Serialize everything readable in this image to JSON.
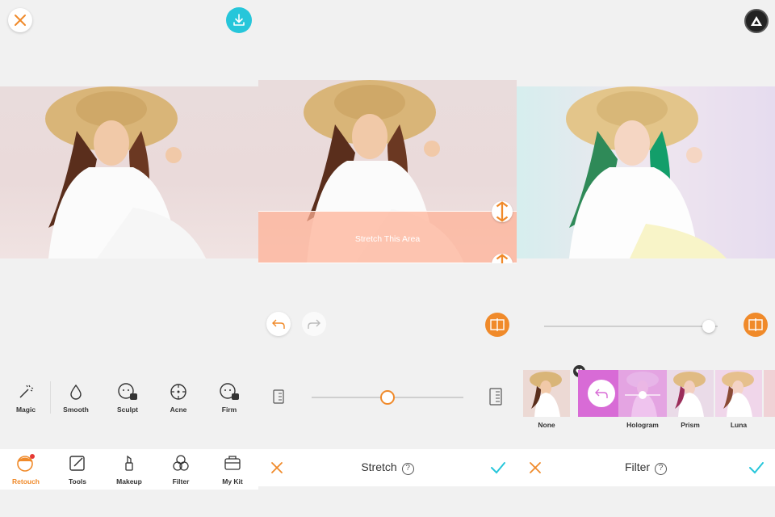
{
  "colors": {
    "accent": "#f08a2a",
    "cyan": "#26c6da",
    "stretch_overlay": "#ffb69b",
    "hologram": "#d86bd6"
  },
  "panel_edit": {
    "close_icon": "close-icon",
    "download_icon": "download-icon",
    "tools": [
      {
        "label": "Magic",
        "icon": "magic-wand-icon"
      },
      {
        "label": "Smooth",
        "icon": "droplet-icon"
      },
      {
        "label": "Sculpt",
        "icon": "face-sculpt-icon"
      },
      {
        "label": "Acne",
        "icon": "acne-target-icon"
      },
      {
        "label": "Firm",
        "icon": "face-firm-icon"
      }
    ],
    "nav": [
      {
        "label": "Retouch",
        "icon": "retouch-face-icon",
        "active": true
      },
      {
        "label": "Tools",
        "icon": "pencil-square-icon"
      },
      {
        "label": "Makeup",
        "icon": "lipstick-icon"
      },
      {
        "label": "Filter",
        "icon": "filter-circles-icon"
      },
      {
        "label": "My Kit",
        "icon": "kit-bag-icon"
      }
    ]
  },
  "panel_stretch": {
    "overlay_label": "Stretch This Area",
    "slider_value": 0.5,
    "bottom_title": "Stretch",
    "help": "?"
  },
  "panel_filter": {
    "slider_value": 0.95,
    "filters": [
      {
        "label": "None"
      },
      {
        "label": ""
      },
      {
        "label": "Hologram"
      },
      {
        "label": "Prism"
      },
      {
        "label": "Luna"
      }
    ],
    "bottom_title": "Filter",
    "help": "?"
  }
}
